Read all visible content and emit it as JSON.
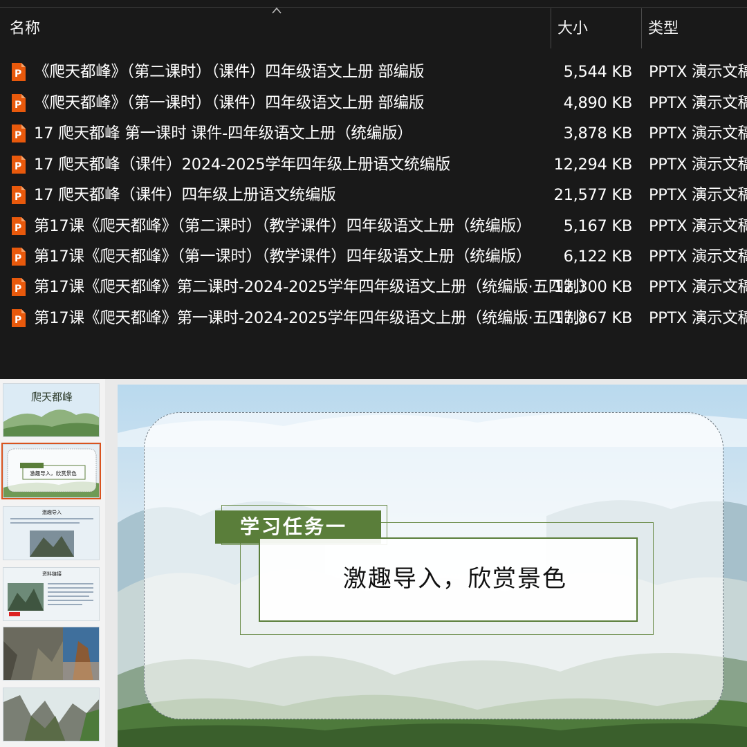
{
  "explorer": {
    "columns": {
      "name": "名称",
      "size": "大小",
      "type": "类型"
    },
    "files": [
      {
        "name": "《爬天都峰》（第二课时）（课件）四年级语文上册 部编版",
        "size": "5,544 KB",
        "type": "PPTX 演示文稿",
        "icon": "pptx-file-icon"
      },
      {
        "name": "《爬天都峰》（第一课时）（课件）四年级语文上册 部编版",
        "size": "4,890 KB",
        "type": "PPTX 演示文稿",
        "icon": "pptx-file-icon"
      },
      {
        "name": "17 爬天都峰 第一课时 课件-四年级语文上册（统编版）",
        "size": "3,878 KB",
        "type": "PPTX 演示文稿",
        "icon": "pptx-file-icon"
      },
      {
        "name": "17 爬天都峰（课件）2024-2025学年四年级上册语文统编版",
        "size": "12,294 KB",
        "type": "PPTX 演示文稿",
        "icon": "pptx-file-icon"
      },
      {
        "name": "17 爬天都峰（课件）四年级上册语文统编版",
        "size": "21,577 KB",
        "type": "PPTX 演示文稿",
        "icon": "pptx-file-icon"
      },
      {
        "name": "第17课《爬天都峰》（第二课时）（教学课件）四年级语文上册（统编版）",
        "size": "5,167 KB",
        "type": "PPTX 演示文稿",
        "icon": "pptx-file-icon"
      },
      {
        "name": "第17课《爬天都峰》（第一课时）（教学课件）四年级语文上册（统编版）",
        "size": "6,122 KB",
        "type": "PPTX 演示文稿",
        "icon": "pptx-file-icon"
      },
      {
        "name": "第17课《爬天都峰》第二课时-2024-2025学年四年级语文上册（统编版·五四制）",
        "size": "12,300 KB",
        "type": "PPTX 演示文稿",
        "icon": "pptx-file-icon"
      },
      {
        "name": "第17课《爬天都峰》第一课时-2024-2025学年四年级语文上册（统编版·五四制）",
        "size": "17,867 KB",
        "type": "PPTX 演示文稿",
        "icon": "pptx-file-icon"
      }
    ]
  },
  "ppt": {
    "thumbnails": [
      {
        "title": "爬天都峰",
        "selected": false
      },
      {
        "title": "激趣导入，欣赏景色",
        "selected": true
      },
      {
        "title": "激趣导入",
        "selected": false
      },
      {
        "title": "资料链接",
        "selected": false
      },
      {
        "title": "",
        "selected": false
      },
      {
        "title": "",
        "selected": false
      }
    ],
    "slide": {
      "task_label": "学习任务一",
      "task_text": "激趣导入，欣赏景色"
    },
    "colors": {
      "accent_green": "#5a7e3a",
      "selection_orange": "#d9531e",
      "explorer_bg": "#191919"
    }
  }
}
